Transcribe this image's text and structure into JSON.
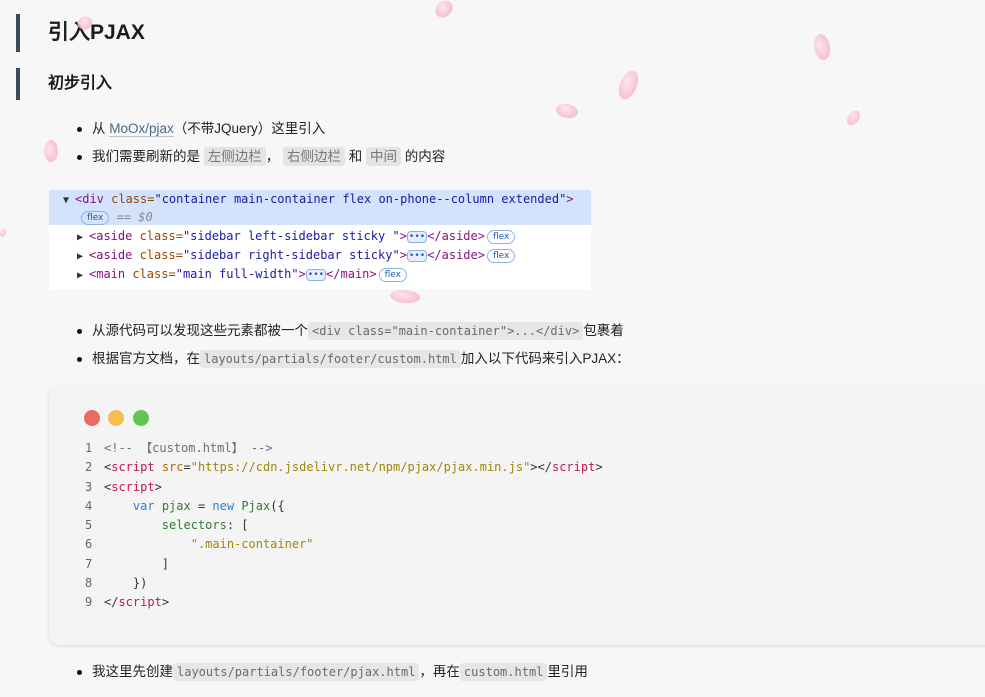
{
  "heading_h2": "引入PJAX",
  "heading_h3": "初步引入",
  "bullets_top": [
    {
      "pre": "从 ",
      "link": "MoOx/pjax",
      "post": "（不带JQuery）这里引入"
    },
    {
      "pre": "我们需要刷新的是 ",
      "chip1": "左侧边栏",
      "sep1": "，",
      "chip2": "右侧边栏",
      "sep2": " 和 ",
      "chip3": "中间",
      "post": " 的内容"
    }
  ],
  "devtools": {
    "line1": {
      "open": "<div ",
      "attr": "class=",
      "val": "\"container main-container flex on-phone--column extended\"",
      "close": ">"
    },
    "line1b": {
      "badge": "flex",
      "eq": "== $0"
    },
    "line2": {
      "open": "<aside ",
      "attr": "class=",
      "val": "\"sidebar left-sidebar sticky \"",
      "close": ">",
      "end": "</aside>",
      "badge": "flex"
    },
    "line3": {
      "open": "<aside ",
      "attr": "class=",
      "val": "\"sidebar right-sidebar sticky\"",
      "close": ">",
      "end": "</aside>",
      "badge": "flex"
    },
    "line4": {
      "open": "<main ",
      "attr": "class=",
      "val": "\"main full-width\"",
      "close": ">",
      "end": "</main>",
      "badge": "flex"
    },
    "ellipsis": "•••"
  },
  "bullets_mid": [
    {
      "pre": "从源代码可以发现这些元素都被一个",
      "code": "<div class=\"main-container\">...</div>",
      "post": "包裹着"
    },
    {
      "pre": "根据官方文档，在",
      "code": "layouts/partials/footer/custom.html",
      "post": "加入以下代码来引入PJAX："
    }
  ],
  "code_block": {
    "window_dots": [
      "#ec6a5e",
      "#f4bf4f",
      "#61c554"
    ],
    "line_numbers": [
      "1",
      "2",
      "3",
      "4",
      "5",
      "6",
      "7",
      "8",
      "9"
    ],
    "l1": "<!-- 【custom.html】 -->",
    "l2_open": "<",
    "l2_tag": "script",
    "l2_attr": " src",
    "l2_eq": "=",
    "l2_val": "\"https://cdn.jsdelivr.net/npm/pjax/pjax.min.js\"",
    "l2_close": "></",
    "l2_tag2": "script",
    "l2_end": ">",
    "l3_open": "<",
    "l3_tag": "script",
    "l3_end": ">",
    "l4_indent": "    ",
    "l4_kw": "var",
    "l4_var": " pjax",
    "l4_eq": " = ",
    "l4_new": "new",
    "l4_fn": " Pjax",
    "l4_end": "({",
    "l5_indent": "        ",
    "l5_key": "selectors",
    "l5_end": ": [",
    "l6_indent": "            ",
    "l6_str": "\".main-container\"",
    "l7_indent": "        ",
    "l7_end": "]",
    "l8_indent": "    ",
    "l8_end": "})",
    "l9_open": "</",
    "l9_tag": "script",
    "l9_end": ">"
  },
  "bullets_bottom": [
    {
      "pre": "我这里先创建",
      "code1": "layouts/partials/footer/pjax.html",
      "mid": "，再在",
      "code2": "custom.html",
      "post": "里引用"
    }
  ]
}
